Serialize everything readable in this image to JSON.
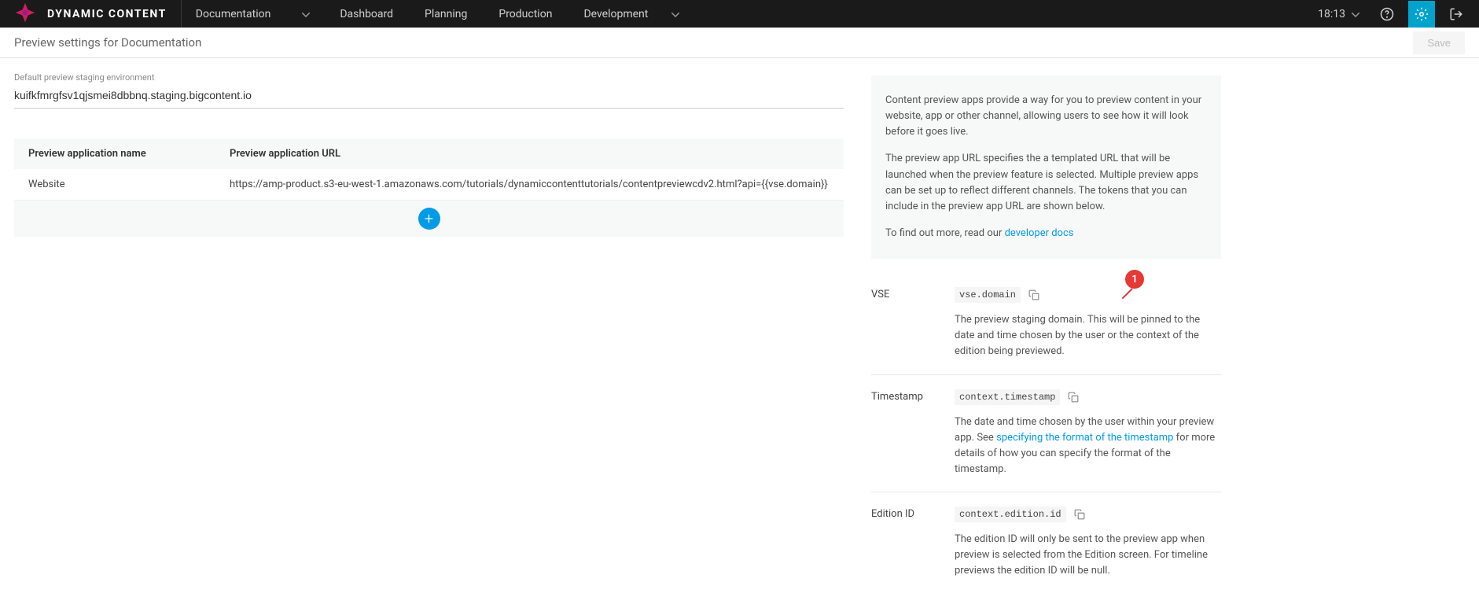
{
  "nav": {
    "brand": "DYNAMIC CONTENT",
    "current_section": "Documentation",
    "items": [
      "Dashboard",
      "Planning",
      "Production",
      "Development"
    ],
    "time": "18:13"
  },
  "header": {
    "title": "Preview settings for Documentation",
    "save_label": "Save"
  },
  "env": {
    "label": "Default preview staging environment",
    "value": "kuifkfmrgfsv1qjsmei8dbbnq.staging.bigcontent.io"
  },
  "table": {
    "col_name": "Preview application name",
    "col_url": "Preview application URL",
    "rows": [
      {
        "name": "Website",
        "url": "https://amp-product.s3-eu-west-1.amazonaws.com/tutorials/dynamiccontenttutorials/contentpreviewcdv2.html?api={{vse.domain}}"
      }
    ]
  },
  "info": {
    "p1": "Content preview apps provide a way for you to preview content in your website, app or other channel, allowing users to see how it will look before it goes live.",
    "p2": "The preview app URL specifies the a templated URL that will be launched when the preview feature is selected. Multiple preview apps can be set up to reflect different channels. The tokens that you can include in the preview app URL are shown below.",
    "p3_prefix": "To find out more, read our ",
    "p3_link": "developer docs",
    "badge": "1",
    "tokens": [
      {
        "label": "VSE",
        "code": "vse.domain",
        "desc": "The preview staging domain. This will be pinned to the date and time chosen by the user or the context of the edition being previewed."
      },
      {
        "label": "Timestamp",
        "code": "context.timestamp",
        "desc_prefix": "The date and time chosen by the user within your preview app. See ",
        "desc_link": "specifying the format of the timestamp",
        "desc_suffix": " for more details of how you can specify the format of the timestamp."
      },
      {
        "label": "Edition ID",
        "code": "context.edition.id",
        "desc": "The edition ID will only be sent to the preview app when preview is selected from the Edition screen. For timeline previews the edition ID will be null."
      }
    ]
  }
}
